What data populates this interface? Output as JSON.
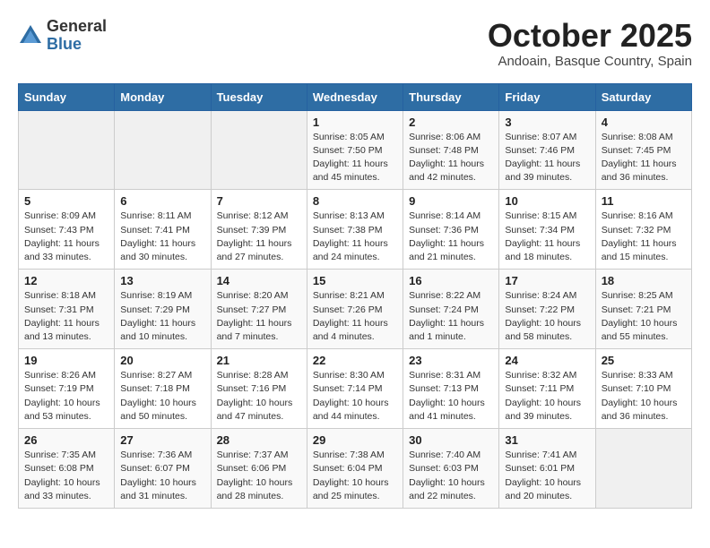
{
  "header": {
    "logo_general": "General",
    "logo_blue": "Blue",
    "month_title": "October 2025",
    "location": "Andoain, Basque Country, Spain"
  },
  "weekdays": [
    "Sunday",
    "Monday",
    "Tuesday",
    "Wednesday",
    "Thursday",
    "Friday",
    "Saturday"
  ],
  "weeks": [
    [
      {
        "day": "",
        "text": ""
      },
      {
        "day": "",
        "text": ""
      },
      {
        "day": "",
        "text": ""
      },
      {
        "day": "1",
        "text": "Sunrise: 8:05 AM\nSunset: 7:50 PM\nDaylight: 11 hours and 45 minutes."
      },
      {
        "day": "2",
        "text": "Sunrise: 8:06 AM\nSunset: 7:48 PM\nDaylight: 11 hours and 42 minutes."
      },
      {
        "day": "3",
        "text": "Sunrise: 8:07 AM\nSunset: 7:46 PM\nDaylight: 11 hours and 39 minutes."
      },
      {
        "day": "4",
        "text": "Sunrise: 8:08 AM\nSunset: 7:45 PM\nDaylight: 11 hours and 36 minutes."
      }
    ],
    [
      {
        "day": "5",
        "text": "Sunrise: 8:09 AM\nSunset: 7:43 PM\nDaylight: 11 hours and 33 minutes."
      },
      {
        "day": "6",
        "text": "Sunrise: 8:11 AM\nSunset: 7:41 PM\nDaylight: 11 hours and 30 minutes."
      },
      {
        "day": "7",
        "text": "Sunrise: 8:12 AM\nSunset: 7:39 PM\nDaylight: 11 hours and 27 minutes."
      },
      {
        "day": "8",
        "text": "Sunrise: 8:13 AM\nSunset: 7:38 PM\nDaylight: 11 hours and 24 minutes."
      },
      {
        "day": "9",
        "text": "Sunrise: 8:14 AM\nSunset: 7:36 PM\nDaylight: 11 hours and 21 minutes."
      },
      {
        "day": "10",
        "text": "Sunrise: 8:15 AM\nSunset: 7:34 PM\nDaylight: 11 hours and 18 minutes."
      },
      {
        "day": "11",
        "text": "Sunrise: 8:16 AM\nSunset: 7:32 PM\nDaylight: 11 hours and 15 minutes."
      }
    ],
    [
      {
        "day": "12",
        "text": "Sunrise: 8:18 AM\nSunset: 7:31 PM\nDaylight: 11 hours and 13 minutes."
      },
      {
        "day": "13",
        "text": "Sunrise: 8:19 AM\nSunset: 7:29 PM\nDaylight: 11 hours and 10 minutes."
      },
      {
        "day": "14",
        "text": "Sunrise: 8:20 AM\nSunset: 7:27 PM\nDaylight: 11 hours and 7 minutes."
      },
      {
        "day": "15",
        "text": "Sunrise: 8:21 AM\nSunset: 7:26 PM\nDaylight: 11 hours and 4 minutes."
      },
      {
        "day": "16",
        "text": "Sunrise: 8:22 AM\nSunset: 7:24 PM\nDaylight: 11 hours and 1 minute."
      },
      {
        "day": "17",
        "text": "Sunrise: 8:24 AM\nSunset: 7:22 PM\nDaylight: 10 hours and 58 minutes."
      },
      {
        "day": "18",
        "text": "Sunrise: 8:25 AM\nSunset: 7:21 PM\nDaylight: 10 hours and 55 minutes."
      }
    ],
    [
      {
        "day": "19",
        "text": "Sunrise: 8:26 AM\nSunset: 7:19 PM\nDaylight: 10 hours and 53 minutes."
      },
      {
        "day": "20",
        "text": "Sunrise: 8:27 AM\nSunset: 7:18 PM\nDaylight: 10 hours and 50 minutes."
      },
      {
        "day": "21",
        "text": "Sunrise: 8:28 AM\nSunset: 7:16 PM\nDaylight: 10 hours and 47 minutes."
      },
      {
        "day": "22",
        "text": "Sunrise: 8:30 AM\nSunset: 7:14 PM\nDaylight: 10 hours and 44 minutes."
      },
      {
        "day": "23",
        "text": "Sunrise: 8:31 AM\nSunset: 7:13 PM\nDaylight: 10 hours and 41 minutes."
      },
      {
        "day": "24",
        "text": "Sunrise: 8:32 AM\nSunset: 7:11 PM\nDaylight: 10 hours and 39 minutes."
      },
      {
        "day": "25",
        "text": "Sunrise: 8:33 AM\nSunset: 7:10 PM\nDaylight: 10 hours and 36 minutes."
      }
    ],
    [
      {
        "day": "26",
        "text": "Sunrise: 7:35 AM\nSunset: 6:08 PM\nDaylight: 10 hours and 33 minutes."
      },
      {
        "day": "27",
        "text": "Sunrise: 7:36 AM\nSunset: 6:07 PM\nDaylight: 10 hours and 31 minutes."
      },
      {
        "day": "28",
        "text": "Sunrise: 7:37 AM\nSunset: 6:06 PM\nDaylight: 10 hours and 28 minutes."
      },
      {
        "day": "29",
        "text": "Sunrise: 7:38 AM\nSunset: 6:04 PM\nDaylight: 10 hours and 25 minutes."
      },
      {
        "day": "30",
        "text": "Sunrise: 7:40 AM\nSunset: 6:03 PM\nDaylight: 10 hours and 22 minutes."
      },
      {
        "day": "31",
        "text": "Sunrise: 7:41 AM\nSunset: 6:01 PM\nDaylight: 10 hours and 20 minutes."
      },
      {
        "day": "",
        "text": ""
      }
    ]
  ]
}
